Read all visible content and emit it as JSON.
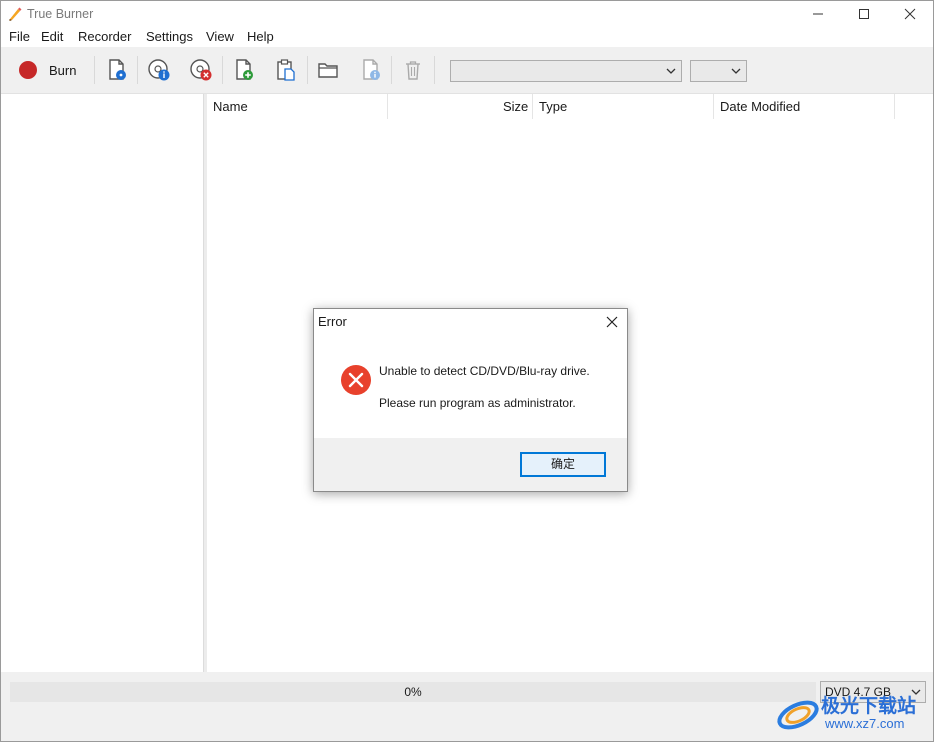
{
  "window": {
    "title": "True Burner",
    "controls": {
      "minimize": "minimize",
      "maximize": "maximize",
      "close": "close"
    }
  },
  "menu": [
    "File",
    "Edit",
    "Recorder",
    "Settings",
    "View",
    "Help"
  ],
  "toolbar": {
    "burn_label": "Burn",
    "buttons": [
      "burn-record-icon",
      "disc-file-icon",
      "disc-info-icon",
      "disc-erase-icon",
      "add-file-icon",
      "paste-icon",
      "folder-icon",
      "file-info-icon",
      "trash-icon"
    ],
    "drive_select": "",
    "speed_select": ""
  },
  "file_list": {
    "columns": [
      "Name",
      "Size",
      "Type",
      "Date Modified"
    ]
  },
  "status": {
    "progress_text": "0%",
    "progress_value": 0,
    "disc_type": "DVD 4.7 GB"
  },
  "dialog": {
    "title": "Error",
    "message_line1": "Unable to detect CD/DVD/Blu-ray drive.",
    "message_line2": "Please run program as administrator.",
    "ok_label": "确定"
  },
  "watermark": {
    "text_main": "极光下载站",
    "text_url": "www.xz7.com"
  },
  "colors": {
    "accent": "#0078d7",
    "burn_red": "#c62828",
    "error_red": "#e8412c",
    "progress_green": "#06b025"
  }
}
